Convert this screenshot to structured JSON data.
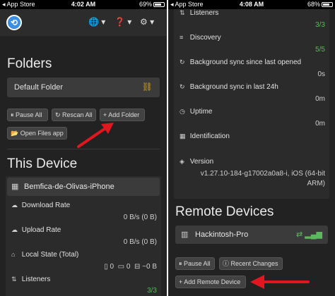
{
  "left": {
    "status": {
      "carrier": "◂ App Store",
      "time": "4:02 AM",
      "battery": "69%"
    },
    "nav": {
      "globe": "🌐 ▾",
      "help": "❓ ▾",
      "settings": "⚙ ▾"
    },
    "folders_heading": "Folders",
    "default_folder": "Default Folder",
    "buttons": {
      "pause_all": "Pause All",
      "rescan_all": "Rescan All",
      "add_folder": "Add Folder",
      "open_files": "Open Files app"
    },
    "this_device_heading": "This Device",
    "device_name": "Bemfica-de-Olivas-iPhone",
    "rows": {
      "download_label": "Download Rate",
      "download_value": "0 B/s (0 B)",
      "upload_label": "Upload Rate",
      "upload_value": "0 B/s (0 B)",
      "local_label": "Local State (Total)",
      "local_files": "0",
      "local_dirs": "0",
      "local_size": "~0 B",
      "listeners_label": "Listeners",
      "listeners_value": "3/3"
    }
  },
  "right": {
    "status": {
      "carrier": "◂ App Store",
      "time": "4:08 AM",
      "battery": "68%"
    },
    "rows": {
      "listeners_label": "Listeners",
      "listeners_value": "3/3",
      "discovery_label": "Discovery",
      "discovery_value": "5/5",
      "bg_sync_opened_label": "Background sync since last opened",
      "bg_sync_opened_value": "0s",
      "bg_sync_24h_label": "Background sync in last 24h",
      "bg_sync_24h_value": "0m",
      "uptime_label": "Uptime",
      "uptime_value": "0m",
      "identification_label": "Identification",
      "version_label": "Version",
      "version_value": "v1.27.10-184-g17002a0a8-i, iOS (64-bit ARM)"
    },
    "remote_heading": "Remote Devices",
    "remote_device": "Hackintosh-Pro",
    "buttons": {
      "pause_all": "Pause All",
      "recent_changes": "Recent Changes",
      "add_remote": "Add Remote Device"
    }
  },
  "colors": {
    "background": "#222222",
    "panel": "#3b3b3b",
    "accent_green": "#5cb85c",
    "arrow_red": "#e0171f",
    "logo_blue": "#3a8ee6"
  }
}
